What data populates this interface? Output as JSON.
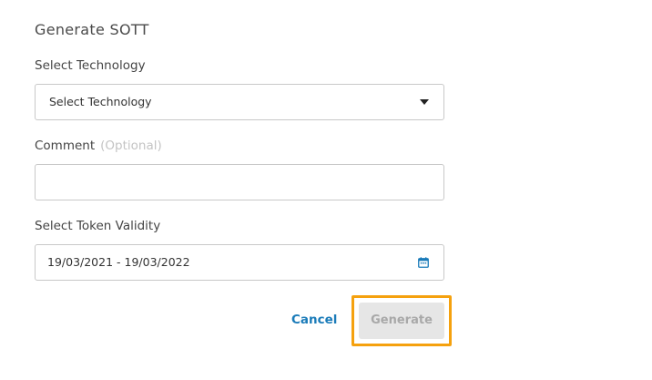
{
  "dialog": {
    "title": "Generate SOTT"
  },
  "technology": {
    "label": "Select Technology",
    "selected_value": "Select Technology"
  },
  "comment": {
    "label": "Comment",
    "optional_hint": "(Optional)",
    "value": ""
  },
  "validity": {
    "label": "Select Token Validity",
    "value": "19/03/2021 - 19/03/2022"
  },
  "actions": {
    "cancel_label": "Cancel",
    "generate_label": "Generate"
  },
  "colors": {
    "link_blue": "#1a7bb9",
    "highlight_orange": "#f5a10e",
    "disabled_button_bg": "#e6e6e6",
    "disabled_button_text": "#a8a8a8"
  },
  "icons": {
    "dropdown": "caret-down-icon",
    "date": "calendar-icon"
  }
}
